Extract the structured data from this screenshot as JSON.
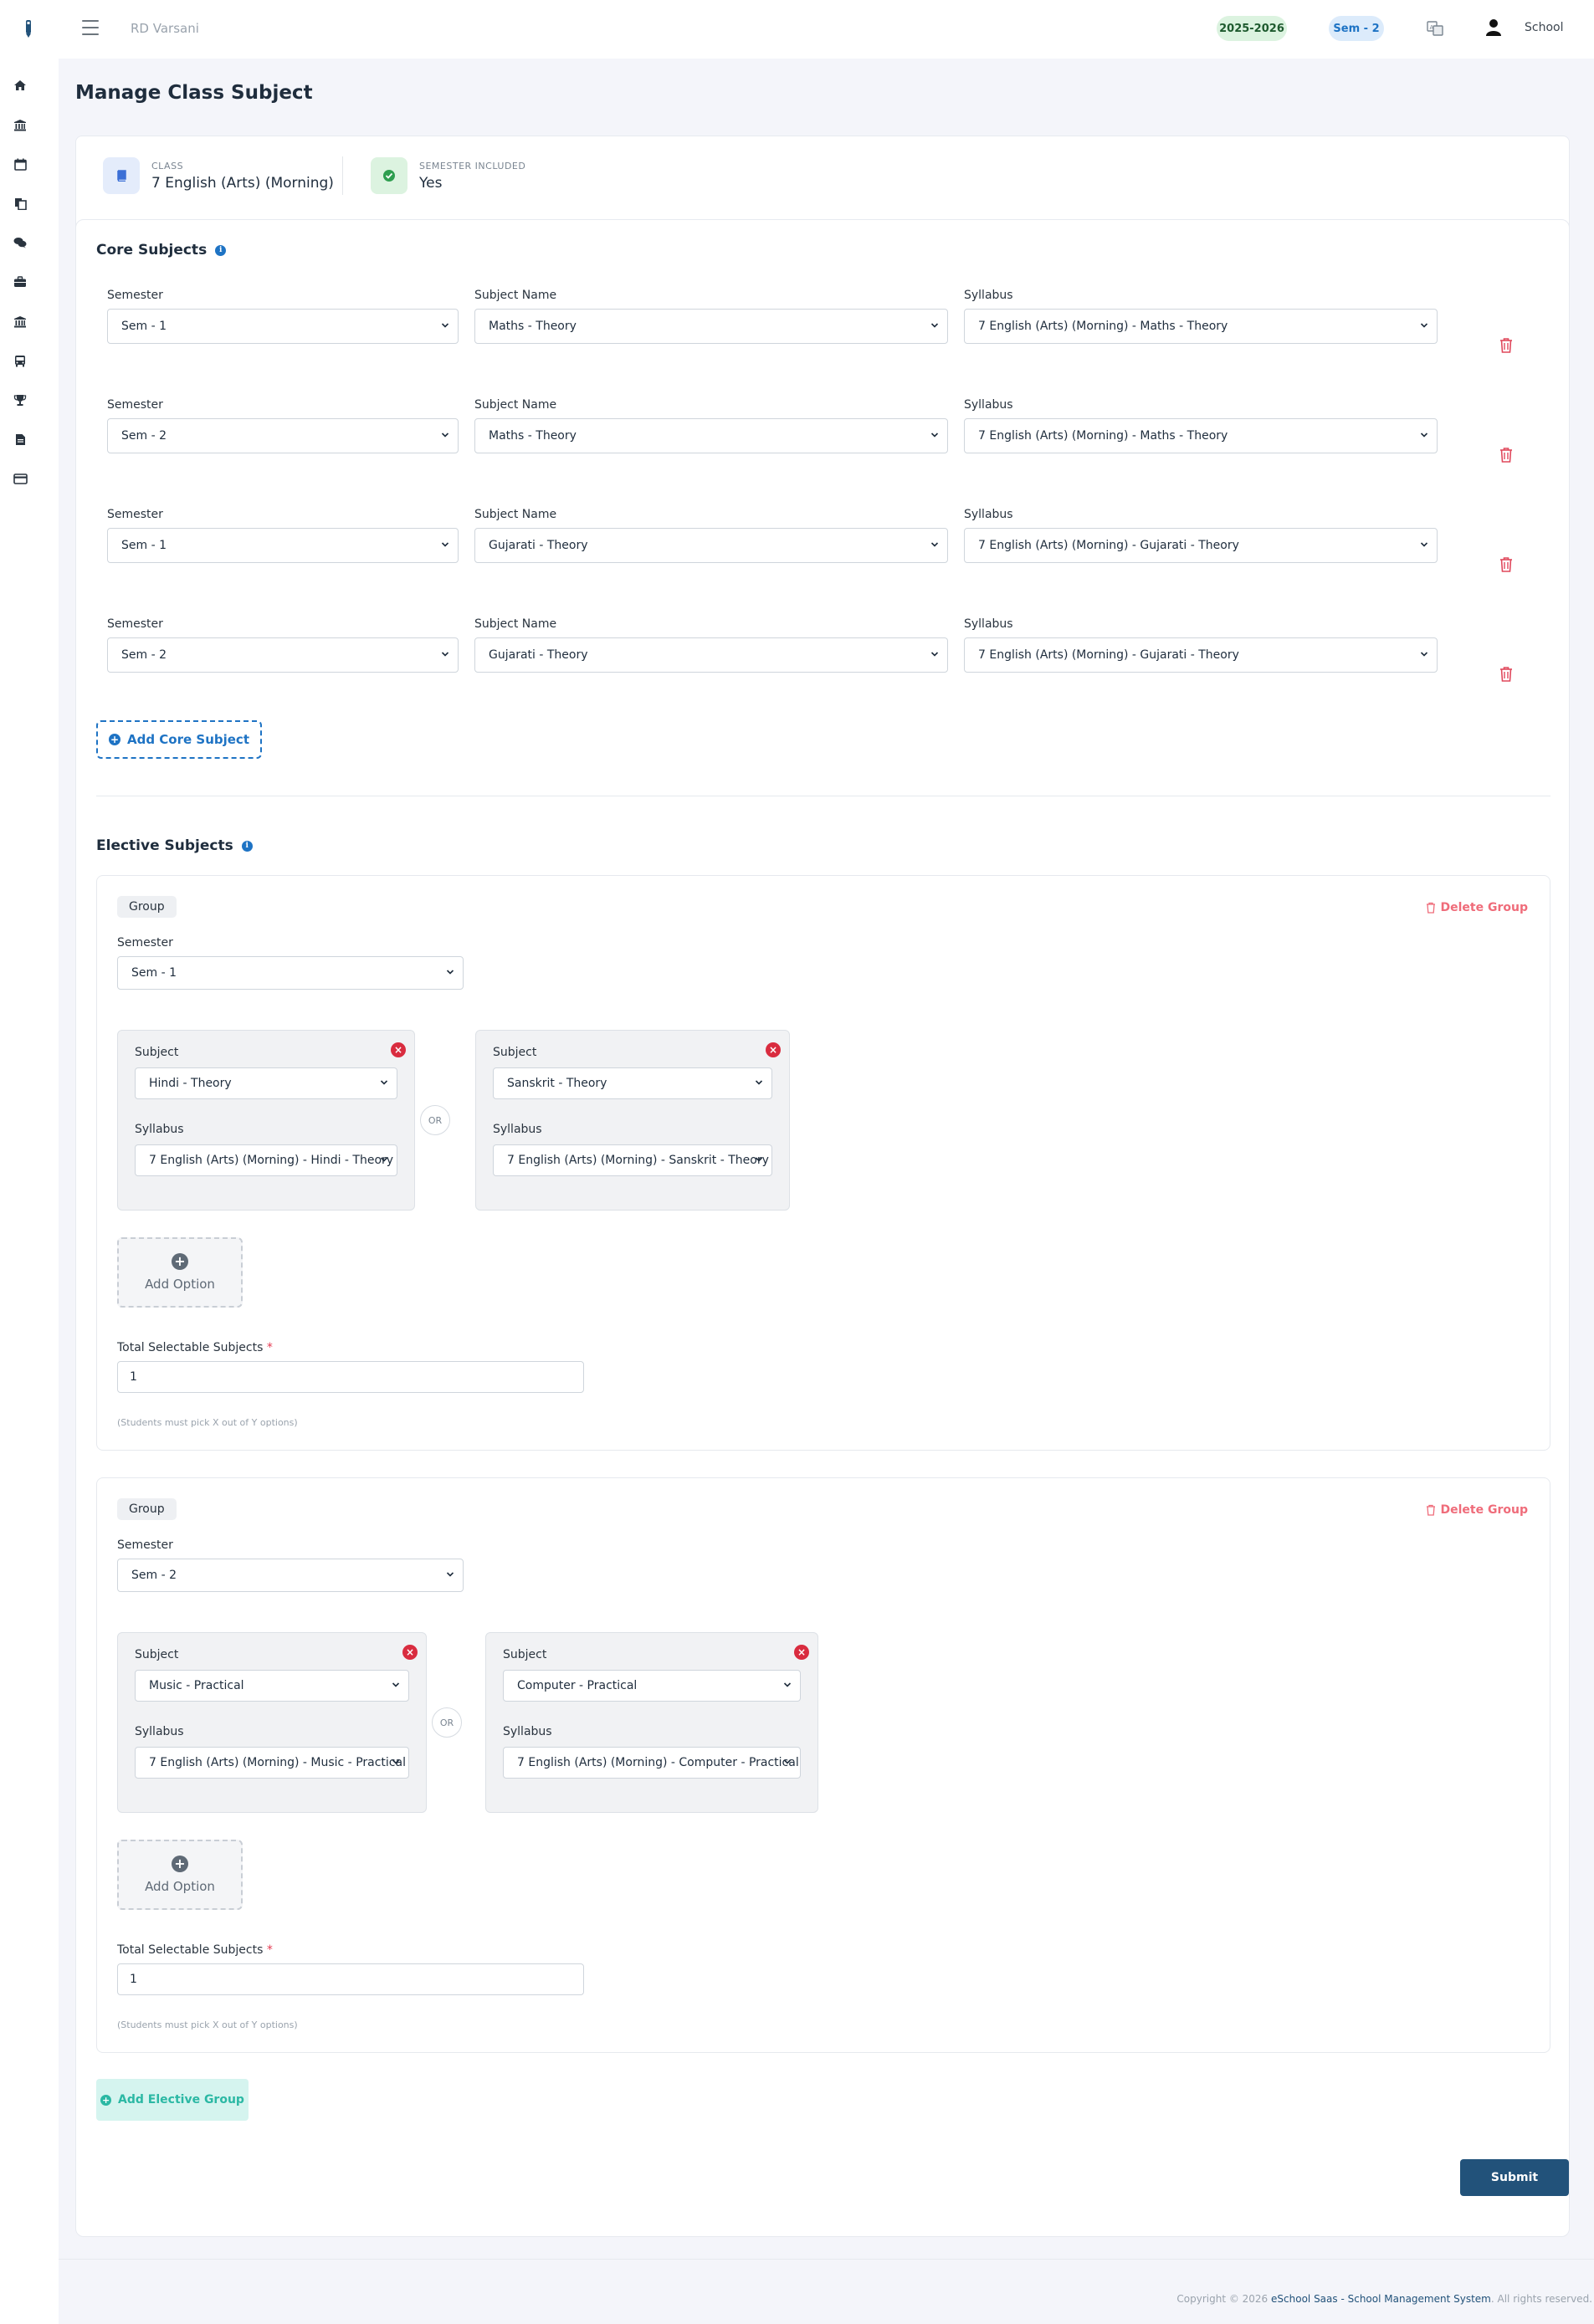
{
  "header": {
    "school_name": "RD Varsani",
    "session_year": "2025-2026",
    "semester": "Sem - 2",
    "user_name": "School"
  },
  "page": {
    "title": "Manage Class Subject"
  },
  "info": {
    "class_label": "CLASS",
    "class_value": "7 English (Arts) (Morning)",
    "semester_label": "SEMESTER INCLUDED",
    "semester_value": "Yes"
  },
  "core": {
    "title": "Core Subjects",
    "semester_label": "Semester",
    "subject_label": "Subject Name",
    "syllabus_label": "Syllabus",
    "rows": [
      {
        "semester": "Sem - 1",
        "subject": "Maths - Theory",
        "syllabus": "7 English (Arts) (Morning) - Maths - Theory"
      },
      {
        "semester": "Sem - 2",
        "subject": "Maths - Theory",
        "syllabus": "7 English (Arts) (Morning) - Maths - Theory"
      },
      {
        "semester": "Sem - 1",
        "subject": "Gujarati - Theory",
        "syllabus": "7 English (Arts) (Morning) - Gujarati - Theory"
      },
      {
        "semester": "Sem - 2",
        "subject": "Gujarati - Theory",
        "syllabus": "7 English (Arts) (Morning) - Gujarati - Theory"
      }
    ],
    "add_label": "Add Core Subject"
  },
  "elective": {
    "title": "Elective Subjects",
    "group_label": "Group",
    "delete_group_label": "Delete Group",
    "semester_label": "Semester",
    "subject_label": "Subject",
    "syllabus_label": "Syllabus",
    "or_label": "OR",
    "add_option_label": "Add Option",
    "total_label": "Total Selectable Subjects",
    "required_mark": "*",
    "hint": "(Students must pick X out of Y options)",
    "groups": [
      {
        "semester": "Sem - 1",
        "options": [
          {
            "subject": "Hindi - Theory",
            "syllabus": "7 English (Arts) (Morning) - Hindi - Theory"
          },
          {
            "subject": "Sanskrit - Theory",
            "syllabus": "7 English (Arts) (Morning) - Sanskrit - Theory"
          }
        ],
        "total": "1"
      },
      {
        "semester": "Sem - 2",
        "options": [
          {
            "subject": "Music - Practical",
            "syllabus": "7 English (Arts) (Morning) - Music - Practical"
          },
          {
            "subject": "Computer - Practical",
            "syllabus": "7 English (Arts) (Morning) - Computer - Practical"
          }
        ],
        "total": "1"
      }
    ],
    "add_group_label": "Add Elective Group"
  },
  "submit_label": "Submit",
  "footer": {
    "prefix": "Copyright © 2026",
    "brand": "eSchool Saas - School Management System",
    "suffix": ". All rights reserved."
  },
  "colors": {
    "primary": "#22527a",
    "accent": "#1e73c4",
    "danger": "#d92c3f",
    "teal": "#2bb8a4"
  },
  "icons": {
    "sidebar": [
      "home-icon",
      "bank-icon",
      "calendar-icon",
      "files-icon",
      "comments-icon",
      "briefcase-icon",
      "bank-icon",
      "bus-icon",
      "trophy-icon",
      "document-icon",
      "credit-card-icon"
    ]
  }
}
